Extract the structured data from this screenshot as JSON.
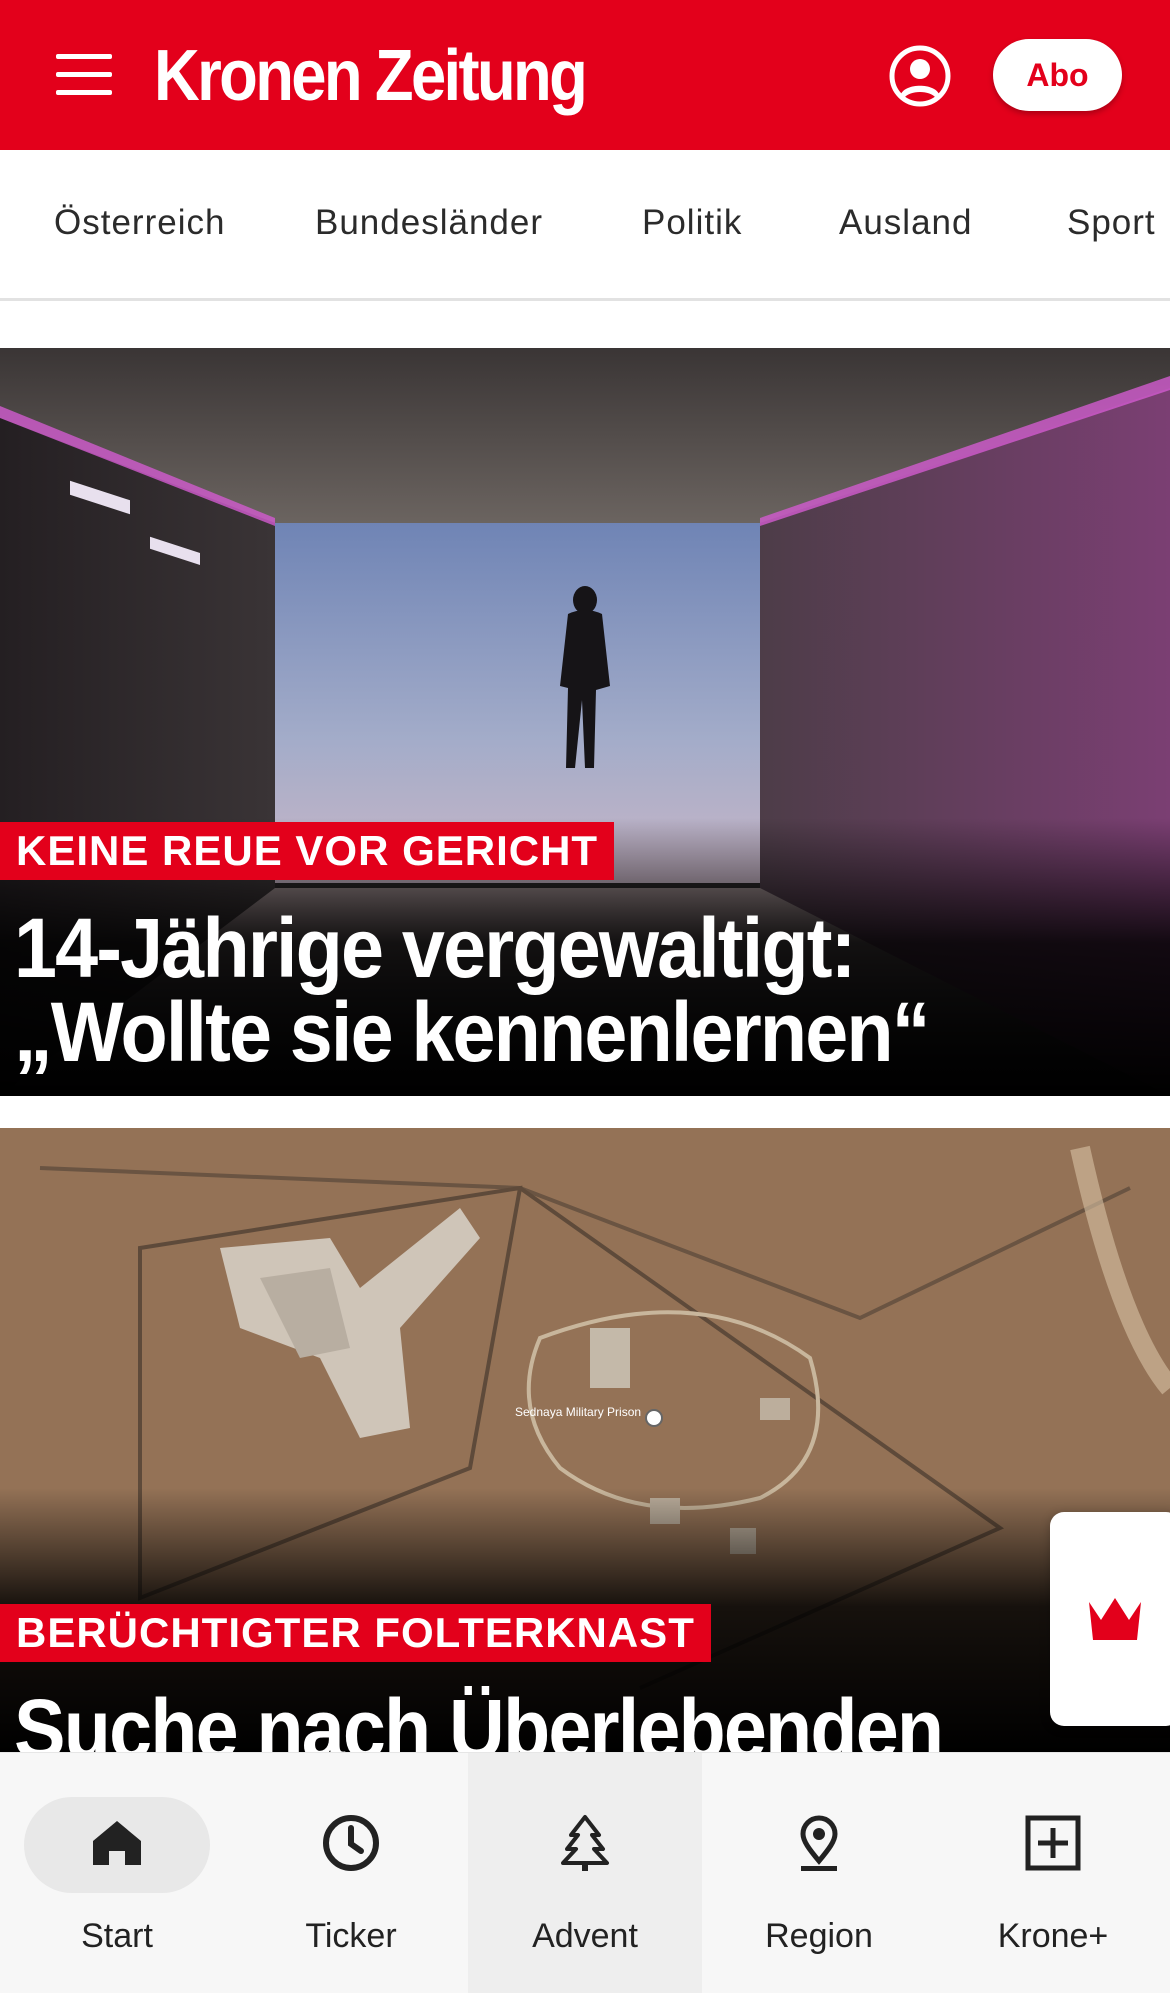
{
  "header": {
    "brand": "Kronen Zeitung",
    "abo_label": "Abo",
    "color": "#e3001b"
  },
  "categories": [
    "Österreich",
    "Bundesländer",
    "Politik",
    "Ausland",
    "Sport"
  ],
  "articles": [
    {
      "kicker": "KEINE REUE VOR GERICHT",
      "headline_line1": "14-Jährige vergewaltigt:",
      "headline_line2": "„Wollte sie kennenlernen“"
    },
    {
      "kicker": "BERÜCHTIGTER FOLTERKNAST",
      "headline_line1": "Suche nach Überlebenden",
      "map_label": "Sednaya Military Prison"
    }
  ],
  "bottom_nav": [
    {
      "label": "Start",
      "icon": "home-icon",
      "active": true
    },
    {
      "label": "Ticker",
      "icon": "clock-icon",
      "active": false
    },
    {
      "label": "Advent",
      "icon": "tree-icon",
      "active": false
    },
    {
      "label": "Region",
      "icon": "location-pin-icon",
      "active": false
    },
    {
      "label": "Krone+",
      "icon": "plus-box-icon",
      "active": false
    }
  ]
}
